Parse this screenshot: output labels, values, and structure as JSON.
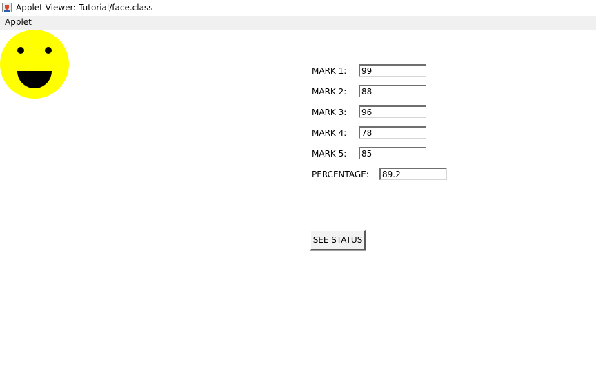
{
  "window": {
    "title": "Applet Viewer: Tutorial/face.class"
  },
  "menu": {
    "items": [
      "Applet"
    ]
  },
  "face": {
    "color": "#ffff00",
    "features_color": "#000000"
  },
  "form": {
    "marks": [
      {
        "label": "MARK 1:",
        "value": "99"
      },
      {
        "label": "MARK 2:",
        "value": "88"
      },
      {
        "label": "MARK 3:",
        "value": "96"
      },
      {
        "label": "MARK 4:",
        "value": "78"
      },
      {
        "label": "MARK 5:",
        "value": "85"
      }
    ],
    "percentage": {
      "label": "PERCENTAGE:",
      "value": "89.2"
    },
    "button_label": "SEE STATUS"
  }
}
